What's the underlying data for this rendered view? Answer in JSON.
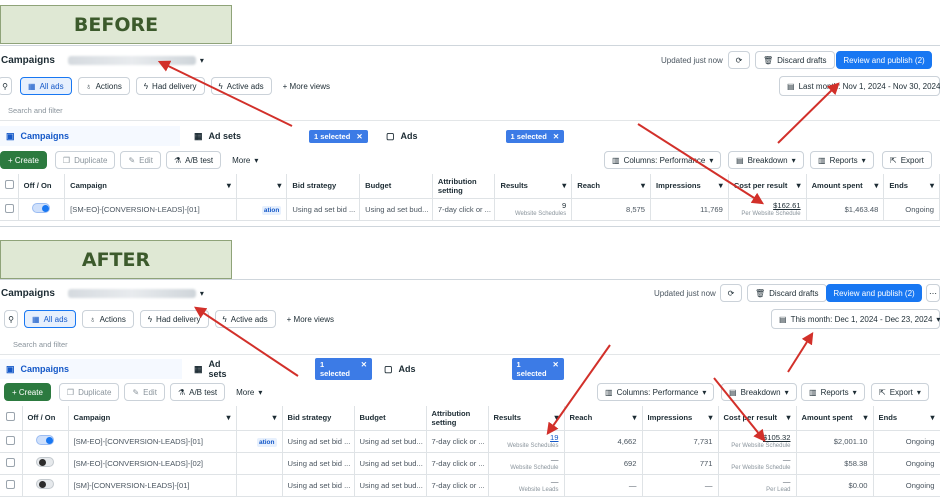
{
  "before": {
    "banner": "BEFORE",
    "campaigns_label": "Campaigns",
    "updated": "Updated just now",
    "discard": "Discard drafts",
    "review": "Review and publish (2)",
    "views": [
      "All ads",
      "Actions",
      "Had delivery",
      "Active ads"
    ],
    "more_views": "+ More views",
    "date_range": "Last month: Nov 1, 2024 - Nov 30, 2024",
    "search_placeholder": "Search and filter",
    "tab_campaigns": "Campaigns",
    "tab_adsets": "Ad sets",
    "tab_ads": "Ads",
    "selected_chip": "1 selected",
    "create": "+ Create",
    "duplicate": "Duplicate",
    "edit": "Edit",
    "ab_test": "A/B test",
    "more": "More",
    "columns": "Columns: Performance",
    "breakdown": "Breakdown",
    "reports": "Reports",
    "export": "Export",
    "headers": [
      "Off / On",
      "Campaign",
      "",
      "Bid strategy",
      "Budget",
      "Attribution setting",
      "Results",
      "Reach",
      "Impressions",
      "Cost per result",
      "Amount spent",
      "Ends"
    ],
    "rows": [
      {
        "campaign": "[SM-EO]-[CONVERSION-LEADS]-[01]",
        "tag": "ation",
        "bid": "Using ad set bid ...",
        "budget": "Using ad set bud...",
        "attribution": "7-day click or ...",
        "results": "9",
        "results_sub": "Website Schedules",
        "reach": "8,575",
        "impressions": "11,769",
        "cpr": "$162.61",
        "cpr_sub": "Per Website Schedule",
        "spent": "$1,463.48",
        "ends": "Ongoing",
        "on": true
      }
    ]
  },
  "after": {
    "banner": "AFTER",
    "campaigns_label": "Campaigns",
    "updated": "Updated just now",
    "discard": "Discard drafts",
    "review": "Review and publish (2)",
    "views": [
      "All ads",
      "Actions",
      "Had delivery",
      "Active ads"
    ],
    "more_views": "+ More views",
    "date_range": "This month: Dec 1, 2024 - Dec 23, 2024",
    "search_placeholder": "Search and filter",
    "tab_campaigns": "Campaigns",
    "tab_adsets": "Ad sets",
    "tab_ads": "Ads",
    "selected_chip": "1 selected",
    "create": "+ Create",
    "duplicate": "Duplicate",
    "edit": "Edit",
    "ab_test": "A/B test",
    "more": "More",
    "columns": "Columns: Performance",
    "breakdown": "Breakdown",
    "reports": "Reports",
    "export": "Export",
    "headers": [
      "Off / On",
      "Campaign",
      "",
      "Bid strategy",
      "Budget",
      "Attribution setting",
      "Results",
      "Reach",
      "Impressions",
      "Cost per result",
      "Amount spent",
      "Ends"
    ],
    "rows": [
      {
        "campaign": "[SM-EO]-[CONVERSION-LEADS]-[01]",
        "tag": "ation",
        "bid": "Using ad set bid ...",
        "budget": "Using ad set bud...",
        "attribution": "7-day click or ...",
        "results": "19",
        "results_sub": "Website Schedules",
        "reach": "4,662",
        "impressions": "7,731",
        "cpr": "$105.32",
        "cpr_sub": "Per Website Schedule",
        "spent": "$2,001.10",
        "ends": "Ongoing",
        "on": true
      },
      {
        "campaign": "[SM-EO]-[CONVERSION-LEADS]-[02]",
        "tag": "",
        "bid": "Using ad set bid ...",
        "budget": "Using ad set bud...",
        "attribution": "7-day click or ...",
        "results": "—",
        "results_sub": "Website Schedule",
        "reach": "692",
        "impressions": "771",
        "cpr": "—",
        "cpr_sub": "Per Website Schedule",
        "spent": "$58.38",
        "ends": "Ongoing",
        "on": false
      },
      {
        "campaign": "[SM]-[CONVERSION-LEADS]-[01]",
        "tag": "",
        "bid": "Using ad set bid ...",
        "budget": "Using ad set bud...",
        "attribution": "7-day click or ...",
        "results": "—",
        "results_sub": "Website Leads",
        "reach": "—",
        "impressions": "—",
        "cpr": "—",
        "cpr_sub": "Per Lead",
        "spent": "$0.00",
        "ends": "Ongoing",
        "on": false
      }
    ]
  },
  "colors": {
    "accent": "#1877f2",
    "arrow": "#d2302a",
    "banner_bg": "#dfe8d4",
    "banner_text": "#3c5a2c"
  }
}
